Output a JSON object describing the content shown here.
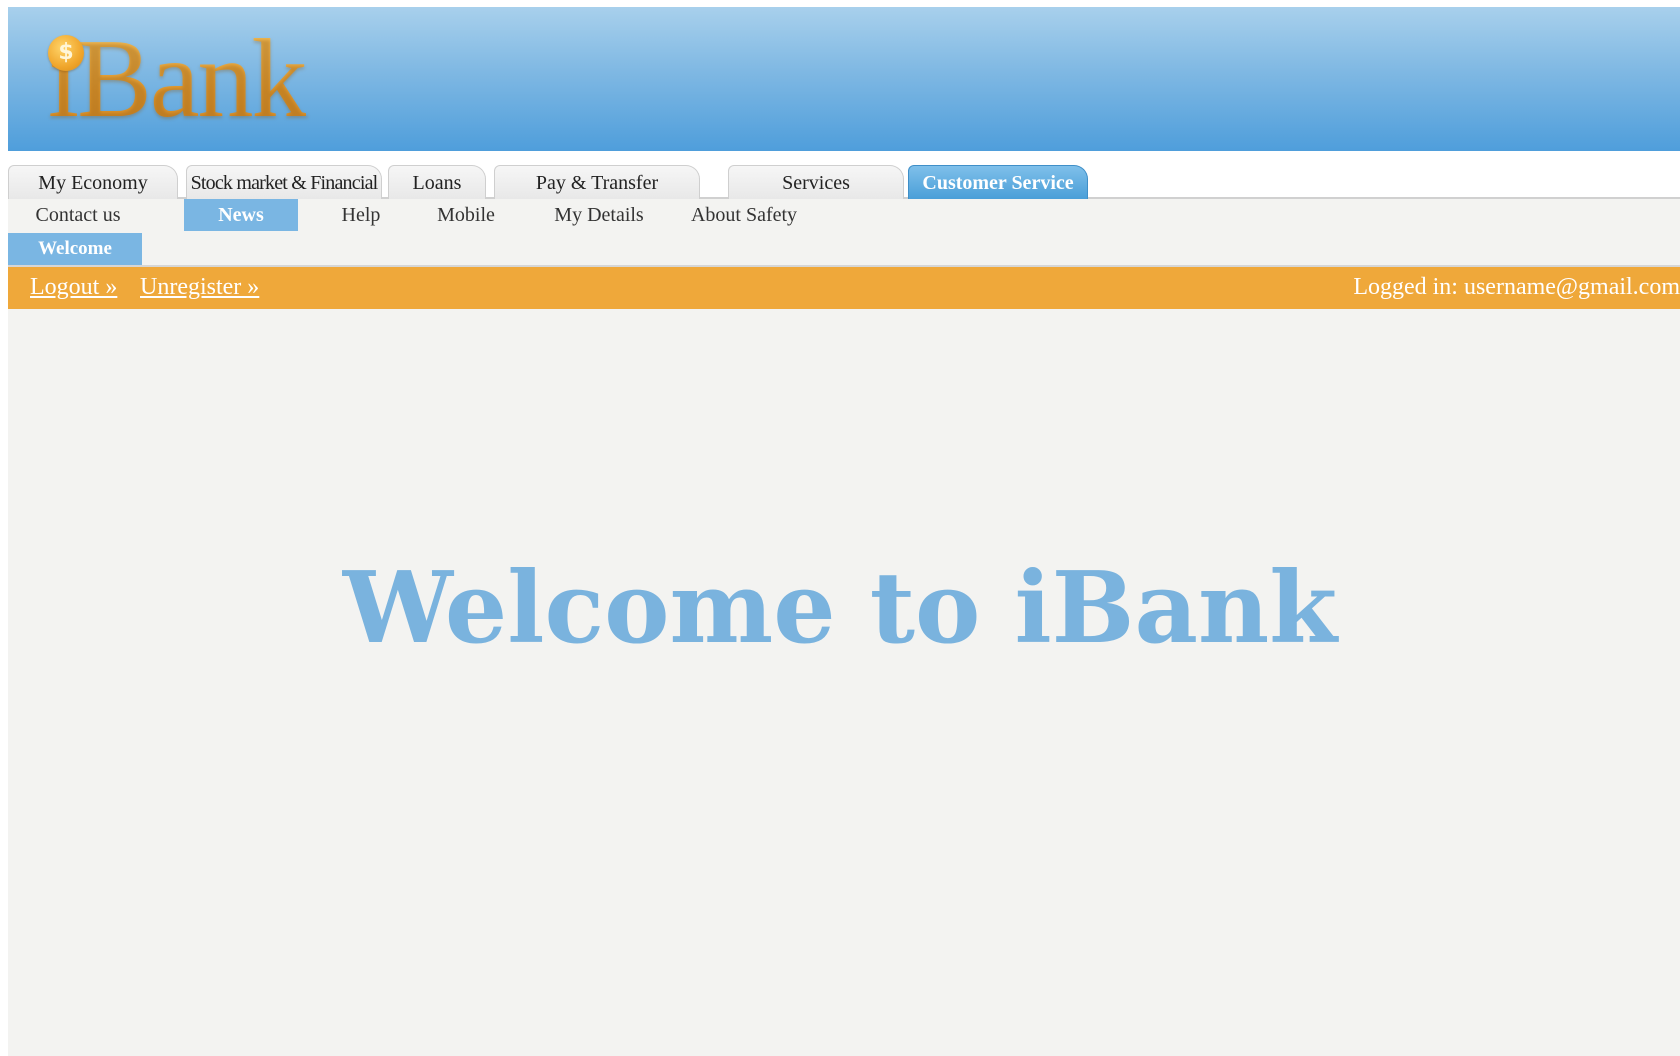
{
  "header": {
    "logo_text": "iBank",
    "logo_coin_symbol": "$"
  },
  "tabs": [
    {
      "label": "My Economy"
    },
    {
      "label": "Stock market & Financial"
    },
    {
      "label": "Loans"
    },
    {
      "label": "Pay & Transfer"
    },
    {
      "label": "Services"
    },
    {
      "label": "Customer Service",
      "active": true
    }
  ],
  "subnav": [
    {
      "label": "Contact us"
    },
    {
      "label": "News",
      "active": true
    },
    {
      "label": "Help"
    },
    {
      "label": "Mobile"
    },
    {
      "label": "My Details"
    },
    {
      "label": "About Safety"
    }
  ],
  "breadcrumb": {
    "label": "Welcome"
  },
  "account_bar": {
    "logout_label": "Logout »",
    "unregister_label": "Unregister »",
    "logged_in_text": "Logged in: username@gmail.com"
  },
  "main": {
    "title": "Welcome to iBank"
  },
  "colors": {
    "header_blue": "#4f9edb",
    "accent_blue": "#7ab6e3",
    "orange_bar": "#efa83a",
    "logo_gold": "#e9a23a",
    "title_blue": "#7ab3de",
    "background": "#f3f3f1"
  }
}
